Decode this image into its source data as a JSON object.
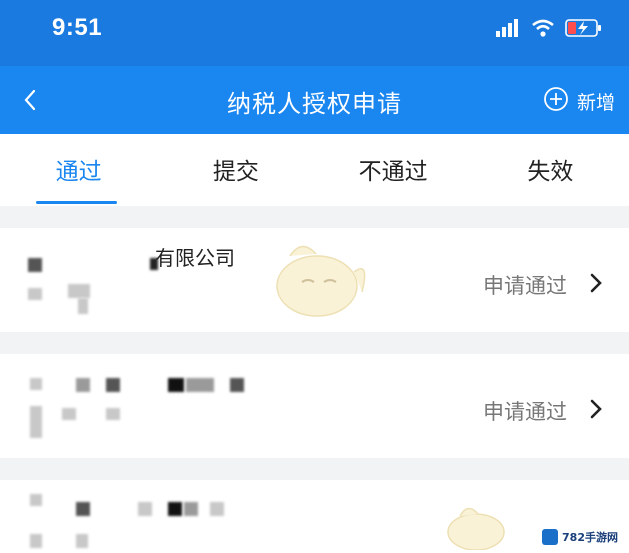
{
  "status_bar": {
    "time": "9:51",
    "signal_icon": "signal-bars-icon",
    "wifi_icon": "wifi-icon",
    "battery_icon": "battery-charging-icon"
  },
  "nav": {
    "title": "纳税人授权申请",
    "back_icon": "chevron-left-icon",
    "add_label": "新增",
    "add_icon": "plus-circle-icon",
    "background": "#1a86f0"
  },
  "tabs": [
    {
      "label": "通过",
      "active": true
    },
    {
      "label": "提交",
      "active": false
    },
    {
      "label": "不通过",
      "active": false
    },
    {
      "label": "失效",
      "active": false
    }
  ],
  "rows": [
    {
      "name": "有限公司",
      "status": "申请通过"
    },
    {
      "name": "",
      "status": "申请通过"
    },
    {
      "name": "",
      "status": ""
    }
  ],
  "watermark": "782手游网",
  "accent_color": "#1a86f0"
}
